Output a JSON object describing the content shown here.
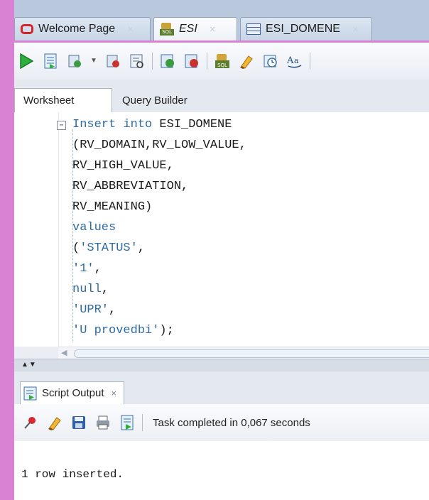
{
  "doc_tabs": [
    {
      "label": "Welcome Page",
      "icon": "oracle-icon",
      "active": false
    },
    {
      "label": "ESI",
      "icon": "sql-worksheet-icon",
      "active": true
    },
    {
      "label": "ESI_DOMENE",
      "icon": "table-icon",
      "active": false
    }
  ],
  "doc_tab_close": "×",
  "toolbar": {
    "icons": [
      "run-icon",
      "run-script-icon",
      "commit-icon",
      "dropdown-icon",
      "rollback-icon",
      "explain-plan-icon",
      "autotrace-icon",
      "sql-tuning-icon",
      "clear-icon",
      "history-icon",
      "format-icon"
    ]
  },
  "sub_tabs": {
    "worksheet": "Worksheet",
    "query_builder": "Query Builder"
  },
  "editor": {
    "fold_marker": "−",
    "lines": [
      {
        "kw": "Insert into",
        "rest": " ESI_DOMENE"
      },
      {
        "kw": "",
        "rest": "(RV_DOMAIN,RV_LOW_VALUE,"
      },
      {
        "kw": "",
        "rest": "RV_HIGH_VALUE,"
      },
      {
        "kw": "",
        "rest": "RV_ABBREVIATION,"
      },
      {
        "kw": "",
        "rest": "RV_MEANING)"
      },
      {
        "kw": "values",
        "rest": ""
      },
      {
        "kw": "",
        "rest": "(",
        "str": "'STATUS'",
        "tail": ","
      },
      {
        "kw": "",
        "rest": "",
        "str": "'1'",
        "tail": ","
      },
      {
        "kw": "null",
        "rest": ","
      },
      {
        "kw": "",
        "rest": "",
        "str": "'UPR'",
        "tail": ","
      },
      {
        "kw": "",
        "rest": "",
        "str": "'U provedbi'",
        "tail": ");"
      }
    ]
  },
  "panel": {
    "tab_label": "Script Output",
    "tab_close": "×",
    "status": "Task completed in 0,067 seconds",
    "output": "1 row inserted."
  },
  "colors": {
    "frame_accent": "#d982d4",
    "keyword": "#2f6ca4"
  }
}
